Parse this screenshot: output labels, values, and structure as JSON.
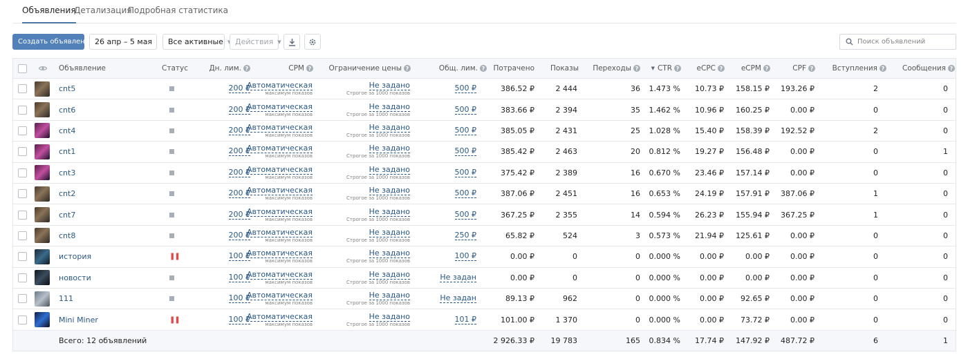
{
  "tabs": [
    {
      "label": "Объявления",
      "active": true
    },
    {
      "label": "Детализация",
      "active": false
    },
    {
      "label": "Подробная статистика",
      "active": false
    }
  ],
  "toolbar": {
    "create_label": "Создать объявление",
    "date_range": "26 апр – 5 мая",
    "filter_label": "Все активные",
    "actions_label": "Действия",
    "download_icon": "download-icon",
    "settings_icon": "gear-icon",
    "search_placeholder": "Поиск объявлений",
    "search_value": ""
  },
  "colors": {
    "accent": "#5181b8",
    "link": "#2a5885",
    "paused": "#e64646",
    "header_bg": "#f5f7fa"
  },
  "columns": {
    "ad": "Объявление",
    "status": "Статус",
    "day_limit": "Дн. лим.",
    "cpm": "CPM",
    "price_limit": "Ограничение цены",
    "total_limit": "Общ. лим.",
    "spent": "Потрачено",
    "impressions": "Показы",
    "clicks": "Переходы",
    "ctr": "CTR",
    "ecpc": "eCPC",
    "ecpm": "eCPM",
    "cpf": "CPF",
    "joins": "Вступления",
    "messages": "Сообщения"
  },
  "cpm_text": "Автоматическая",
  "cpm_sub": "максимум показов",
  "price_text": "Не задано",
  "price_sub": "Строгое за 1000 показов",
  "rows": [
    {
      "name": "cnt5",
      "status": "active",
      "day_limit": "200 ₽",
      "total_limit": "500 ₽",
      "spent": "386.52 ₽",
      "impressions": "2 444",
      "clicks": "36",
      "ctr": "1.473 %",
      "ecpc": "10.73 ₽",
      "ecpm": "158.15 ₽",
      "cpf": "193.26 ₽",
      "joins": "2",
      "messages": "0",
      "status_symbol": "■"
    },
    {
      "name": "cnt6",
      "status": "active",
      "day_limit": "200 ₽",
      "total_limit": "500 ₽",
      "spent": "383.66 ₽",
      "impressions": "2 394",
      "clicks": "35",
      "ctr": "1.462 %",
      "ecpc": "10.96 ₽",
      "ecpm": "160.25 ₽",
      "cpf": "0.00 ₽",
      "joins": "0",
      "messages": "0",
      "status_symbol": "■"
    },
    {
      "name": "cnt4",
      "status": "active",
      "day_limit": "200 ₽",
      "total_limit": "500 ₽",
      "spent": "385.05 ₽",
      "impressions": "2 431",
      "clicks": "25",
      "ctr": "1.028 %",
      "ecpc": "15.40 ₽",
      "ecpm": "158.39 ₽",
      "cpf": "192.52 ₽",
      "joins": "2",
      "messages": "0",
      "status_symbol": "■"
    },
    {
      "name": "cnt1",
      "status": "active",
      "day_limit": "200 ₽",
      "total_limit": "500 ₽",
      "spent": "385.42 ₽",
      "impressions": "2 463",
      "clicks": "20",
      "ctr": "0.812 %",
      "ecpc": "19.27 ₽",
      "ecpm": "156.48 ₽",
      "cpf": "0.00 ₽",
      "joins": "0",
      "messages": "1",
      "status_symbol": "■"
    },
    {
      "name": "cnt3",
      "status": "active",
      "day_limit": "200 ₽",
      "total_limit": "500 ₽",
      "spent": "375.42 ₽",
      "impressions": "2 389",
      "clicks": "16",
      "ctr": "0.670 %",
      "ecpc": "23.46 ₽",
      "ecpm": "157.14 ₽",
      "cpf": "0.00 ₽",
      "joins": "0",
      "messages": "0",
      "status_symbol": "■"
    },
    {
      "name": "cnt2",
      "status": "active",
      "day_limit": "200 ₽",
      "total_limit": "500 ₽",
      "spent": "387.06 ₽",
      "impressions": "2 451",
      "clicks": "16",
      "ctr": "0.653 %",
      "ecpc": "24.19 ₽",
      "ecpm": "157.91 ₽",
      "cpf": "387.06 ₽",
      "joins": "1",
      "messages": "0",
      "status_symbol": "■"
    },
    {
      "name": "cnt7",
      "status": "active",
      "day_limit": "200 ₽",
      "total_limit": "500 ₽",
      "spent": "367.25 ₽",
      "impressions": "2 355",
      "clicks": "14",
      "ctr": "0.594 %",
      "ecpc": "26.23 ₽",
      "ecpm": "155.94 ₽",
      "cpf": "367.25 ₽",
      "joins": "1",
      "messages": "0",
      "status_symbol": "■"
    },
    {
      "name": "cnt8",
      "status": "active",
      "day_limit": "200 ₽",
      "total_limit": "250 ₽",
      "spent": "65.82 ₽",
      "impressions": "524",
      "clicks": "3",
      "ctr": "0.573 %",
      "ecpc": "21.94 ₽",
      "ecpm": "125.61 ₽",
      "cpf": "0.00 ₽",
      "joins": "0",
      "messages": "0",
      "status_symbol": "■"
    },
    {
      "name": "история",
      "status": "paused",
      "day_limit": "100 ₽",
      "total_limit": "100 ₽",
      "spent": "0.00 ₽",
      "impressions": "0",
      "clicks": "0",
      "ctr": "0.000 %",
      "ecpc": "0.00 ₽",
      "ecpm": "0.00 ₽",
      "cpf": "0.00 ₽",
      "joins": "0",
      "messages": "0",
      "status_symbol": "❚❚"
    },
    {
      "name": "новости",
      "status": "active",
      "day_limit": "100 ₽",
      "total_limit": "Не задан",
      "spent": "0.00 ₽",
      "impressions": "0",
      "clicks": "0",
      "ctr": "0.000 %",
      "ecpc": "0.00 ₽",
      "ecpm": "0.00 ₽",
      "cpf": "0.00 ₽",
      "joins": "0",
      "messages": "0",
      "status_symbol": "■"
    },
    {
      "name": "111",
      "status": "active",
      "day_limit": "100 ₽",
      "total_limit": "Не задан",
      "spent": "89.13 ₽",
      "impressions": "962",
      "clicks": "0",
      "ctr": "0.000 %",
      "ecpc": "0.00 ₽",
      "ecpm": "92.65 ₽",
      "cpf": "0.00 ₽",
      "joins": "0",
      "messages": "0",
      "status_symbol": "■"
    },
    {
      "name": "Mini Miner",
      "status": "paused",
      "day_limit": "100 ₽",
      "total_limit": "101 ₽",
      "spent": "101.00 ₽",
      "impressions": "1 370",
      "clicks": "0",
      "ctr": "0.000 %",
      "ecpc": "0.00 ₽",
      "ecpm": "73.72 ₽",
      "cpf": "0.00 ₽",
      "joins": "0",
      "messages": "0",
      "status_symbol": "❚❚"
    }
  ],
  "totals": {
    "label": "Всего: 12 объявлений",
    "spent": "2 926.33 ₽",
    "impressions": "19 783",
    "clicks": "165",
    "ctr": "0.834 %",
    "ecpc": "17.74 ₽",
    "ecpm": "147.92 ₽",
    "cpf": "487.72 ₽",
    "joins": "6",
    "messages": "1"
  }
}
